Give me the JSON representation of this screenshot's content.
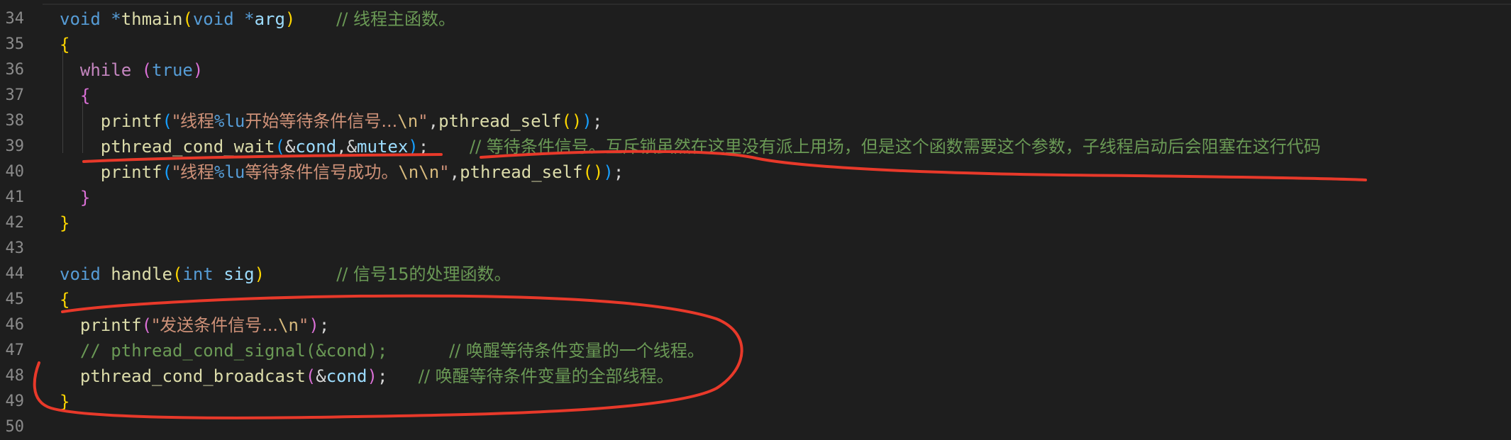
{
  "editor": {
    "lines": [
      {
        "num": "34",
        "tokens": [
          {
            "t": "void",
            "c": "kw"
          },
          {
            "t": " ",
            "c": "op"
          },
          {
            "t": "*",
            "c": "kw"
          },
          {
            "t": "thmain",
            "c": "fn"
          },
          {
            "t": "(",
            "c": "b1"
          },
          {
            "t": "void",
            "c": "kw"
          },
          {
            "t": " ",
            "c": "op"
          },
          {
            "t": "*",
            "c": "kw"
          },
          {
            "t": "arg",
            "c": "var"
          },
          {
            "t": ")",
            "c": "b1"
          },
          {
            "t": "    ",
            "c": "op"
          },
          {
            "t": "// 线程主函数。",
            "c": "cmt-cn"
          }
        ]
      },
      {
        "num": "35",
        "tokens": [
          {
            "t": "{",
            "c": "b1"
          }
        ]
      },
      {
        "num": "36",
        "tokens": [
          {
            "t": "  ",
            "c": "op"
          },
          {
            "t": "while",
            "c": "ctl"
          },
          {
            "t": " ",
            "c": "op"
          },
          {
            "t": "(",
            "c": "b2"
          },
          {
            "t": "true",
            "c": "kw"
          },
          {
            "t": ")",
            "c": "b2"
          }
        ]
      },
      {
        "num": "37",
        "tokens": [
          {
            "t": "  ",
            "c": "op"
          },
          {
            "t": "{",
            "c": "b2"
          }
        ]
      },
      {
        "num": "38",
        "tokens": [
          {
            "t": "    ",
            "c": "op"
          },
          {
            "t": "printf",
            "c": "fn"
          },
          {
            "t": "(",
            "c": "b3"
          },
          {
            "t": "\"线程",
            "c": "str-cn"
          },
          {
            "t": "%lu",
            "c": "fmt"
          },
          {
            "t": "开始等待条件信号...",
            "c": "str-cn"
          },
          {
            "t": "\\n",
            "c": "esc"
          },
          {
            "t": "\"",
            "c": "str"
          },
          {
            "t": ",",
            "c": "op"
          },
          {
            "t": "pthread_self",
            "c": "fn"
          },
          {
            "t": "(",
            "c": "b1"
          },
          {
            "t": ")",
            "c": "b1"
          },
          {
            "t": ")",
            "c": "b3"
          },
          {
            "t": ";",
            "c": "op"
          }
        ]
      },
      {
        "num": "39",
        "tokens": [
          {
            "t": "    ",
            "c": "op"
          },
          {
            "t": "pthread_cond_wait",
            "c": "fn"
          },
          {
            "t": "(",
            "c": "b3"
          },
          {
            "t": "&",
            "c": "op"
          },
          {
            "t": "cond",
            "c": "var"
          },
          {
            "t": ",",
            "c": "op"
          },
          {
            "t": "&",
            "c": "op"
          },
          {
            "t": "mutex",
            "c": "var"
          },
          {
            "t": ")",
            "c": "b3"
          },
          {
            "t": ";",
            "c": "op"
          },
          {
            "t": "    ",
            "c": "op"
          },
          {
            "t": "// 等待条件信号。互斥锁虽然在这里没有派上用场，但是这个函数需要这个参数，子线程启动后会阻塞在这行代码",
            "c": "cmt-cn"
          }
        ]
      },
      {
        "num": "40",
        "tokens": [
          {
            "t": "    ",
            "c": "op"
          },
          {
            "t": "printf",
            "c": "fn"
          },
          {
            "t": "(",
            "c": "b3"
          },
          {
            "t": "\"线程",
            "c": "str-cn"
          },
          {
            "t": "%lu",
            "c": "fmt"
          },
          {
            "t": "等待条件信号成功。",
            "c": "str-cn"
          },
          {
            "t": "\\n\\n",
            "c": "esc"
          },
          {
            "t": "\"",
            "c": "str"
          },
          {
            "t": ",",
            "c": "op"
          },
          {
            "t": "pthread_self",
            "c": "fn"
          },
          {
            "t": "(",
            "c": "b1"
          },
          {
            "t": ")",
            "c": "b1"
          },
          {
            "t": ")",
            "c": "b3"
          },
          {
            "t": ";",
            "c": "op"
          }
        ]
      },
      {
        "num": "41",
        "tokens": [
          {
            "t": "  ",
            "c": "op"
          },
          {
            "t": "}",
            "c": "b2"
          }
        ]
      },
      {
        "num": "42",
        "tokens": [
          {
            "t": "}",
            "c": "b1"
          }
        ]
      },
      {
        "num": "43",
        "tokens": []
      },
      {
        "num": "44",
        "tokens": [
          {
            "t": "void",
            "c": "kw"
          },
          {
            "t": " ",
            "c": "op"
          },
          {
            "t": "handle",
            "c": "fn"
          },
          {
            "t": "(",
            "c": "b1"
          },
          {
            "t": "int",
            "c": "kw"
          },
          {
            "t": " ",
            "c": "op"
          },
          {
            "t": "sig",
            "c": "var"
          },
          {
            "t": ")",
            "c": "b1"
          },
          {
            "t": "       ",
            "c": "op"
          },
          {
            "t": "// 信号15的处理函数。",
            "c": "cmt-cn"
          }
        ]
      },
      {
        "num": "45",
        "tokens": [
          {
            "t": "{",
            "c": "b1"
          }
        ]
      },
      {
        "num": "46",
        "tokens": [
          {
            "t": "  ",
            "c": "op"
          },
          {
            "t": "printf",
            "c": "fn"
          },
          {
            "t": "(",
            "c": "b2"
          },
          {
            "t": "\"发送条件信号...",
            "c": "str-cn"
          },
          {
            "t": "\\n",
            "c": "esc"
          },
          {
            "t": "\"",
            "c": "str"
          },
          {
            "t": ")",
            "c": "b2"
          },
          {
            "t": ";",
            "c": "op"
          }
        ]
      },
      {
        "num": "47",
        "tokens": [
          {
            "t": "  ",
            "c": "op"
          },
          {
            "t": "// pthread_cond_signal(&cond);      ",
            "c": "cmt"
          },
          {
            "t": "// 唤醒等待条件变量的一个线程。",
            "c": "cmt-cn"
          }
        ]
      },
      {
        "num": "48",
        "tokens": [
          {
            "t": "  ",
            "c": "op"
          },
          {
            "t": "pthread_cond_broadcast",
            "c": "fn"
          },
          {
            "t": "(",
            "c": "b2"
          },
          {
            "t": "&",
            "c": "op"
          },
          {
            "t": "cond",
            "c": "var"
          },
          {
            "t": ")",
            "c": "b2"
          },
          {
            "t": ";",
            "c": "op"
          },
          {
            "t": "   ",
            "c": "op"
          },
          {
            "t": "// 唤醒等待条件变量的全部线程。",
            "c": "cmt-cn"
          }
        ]
      },
      {
        "num": "49",
        "tokens": [
          {
            "t": "}",
            "c": "b1"
          }
        ]
      },
      {
        "num": "50",
        "tokens": []
      }
    ]
  },
  "colors": {
    "background": "#1e1e1e",
    "annotation": "#e8392a"
  }
}
